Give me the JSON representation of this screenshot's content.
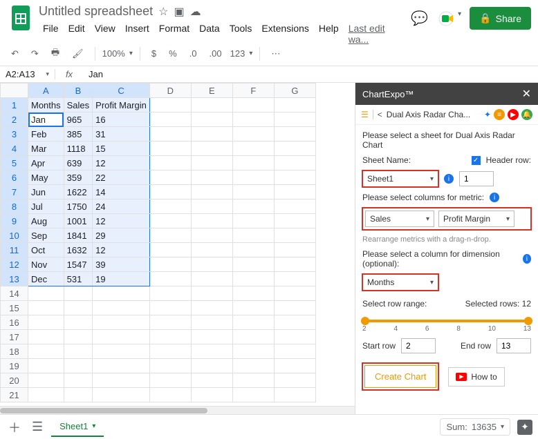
{
  "header": {
    "doc_title": "Untitled spreadsheet",
    "menus": [
      "File",
      "Edit",
      "View",
      "Insert",
      "Format",
      "Data",
      "Tools",
      "Extensions",
      "Help"
    ],
    "last_edit": "Last edit wa...",
    "share": "Share"
  },
  "toolbar": {
    "zoom": "100%",
    "fmt": "123"
  },
  "namebox": "A2:A13",
  "fx_value": "Jan",
  "columns": [
    "A",
    "B",
    "C",
    "D",
    "E",
    "F",
    "G"
  ],
  "row_count": 21,
  "data": {
    "headers": [
      "Months",
      "Sales",
      "Profit Margin"
    ],
    "rows": [
      [
        "Jan",
        "965",
        "16"
      ],
      [
        "Feb",
        "385",
        "31"
      ],
      [
        "Mar",
        "1118",
        "15"
      ],
      [
        "Apr",
        "639",
        "12"
      ],
      [
        "May",
        "359",
        "22"
      ],
      [
        "Jun",
        "1622",
        "14"
      ],
      [
        "Jul",
        "1750",
        "24"
      ],
      [
        "Aug",
        "1001",
        "12"
      ],
      [
        "Sep",
        "1841",
        "29"
      ],
      [
        "Oct",
        "1632",
        "12"
      ],
      [
        "Nov",
        "1547",
        "39"
      ],
      [
        "Dec",
        "531",
        "19"
      ]
    ]
  },
  "tabs": {
    "sheet": "Sheet1"
  },
  "status": {
    "sum_label": "Sum:",
    "sum_value": "13635"
  },
  "sidepanel": {
    "title": "ChartExpo™",
    "chart_name": "Dual Axis Radar Cha...",
    "prompt_sheet": "Please select a sheet for Dual Axis Radar Chart",
    "sheet_name_label": "Sheet Name:",
    "header_row_label": "Header row:",
    "sheet_selected": "Sheet1",
    "header_row_value": "1",
    "prompt_metrics": "Please select columns for metric:",
    "metric1": "Sales",
    "metric2": "Profit Margin",
    "rearrange_note": "Rearrange metrics with a drag-n-drop.",
    "prompt_dimension": "Please select a column for dimension (optional):",
    "dimension": "Months",
    "range_label": "Select row range:",
    "selected_rows": "Selected rows: 12",
    "ticks": [
      "2",
      "4",
      "6",
      "8",
      "10",
      "13"
    ],
    "start_row_label": "Start row",
    "start_row": "2",
    "end_row_label": "End row",
    "end_row": "13",
    "create": "Create Chart",
    "howto": "How to"
  },
  "chart_data": {
    "type": "table",
    "title": "Dual Axis Radar Chart source data",
    "categories": [
      "Jan",
      "Feb",
      "Mar",
      "Apr",
      "May",
      "Jun",
      "Jul",
      "Aug",
      "Sep",
      "Oct",
      "Nov",
      "Dec"
    ],
    "series": [
      {
        "name": "Sales",
        "values": [
          965,
          385,
          1118,
          639,
          359,
          1622,
          1750,
          1001,
          1841,
          1632,
          1547,
          531
        ]
      },
      {
        "name": "Profit Margin",
        "values": [
          16,
          31,
          15,
          12,
          22,
          14,
          24,
          12,
          29,
          12,
          39,
          19
        ]
      }
    ]
  }
}
